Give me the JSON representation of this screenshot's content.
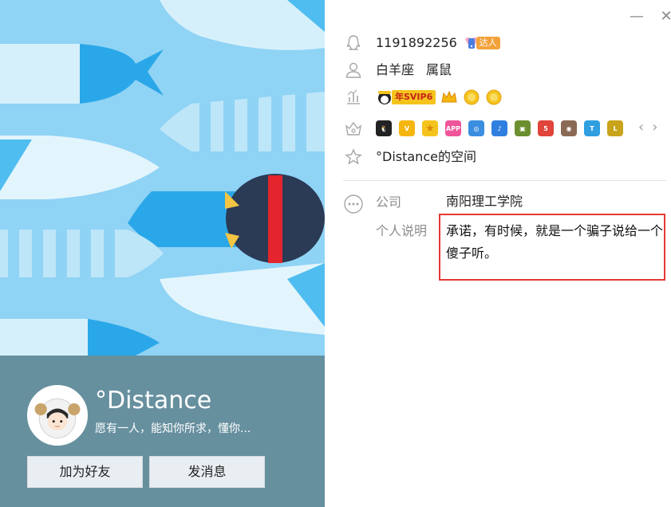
{
  "window": {
    "minimize_glyph": "—",
    "close_glyph": "✕"
  },
  "profile": {
    "nickname": "°Distance",
    "signature": "愿有一人，能知你所求，懂你...",
    "add_friend_label": "加为好友",
    "send_message_label": "发消息"
  },
  "info": {
    "qq_number": "1191892256",
    "talent_badge": "达人",
    "zodiac": "白羊座",
    "chinese_zodiac": "属鼠",
    "vip_badge": "年SVIP6",
    "qzone": "°Distance的空间"
  },
  "details": {
    "company_label": "公司",
    "company_value": "南阳理工学院",
    "description_label": "个人说明",
    "description_value": "承诺，有时候，就是一个骗子说给一个傻子听。"
  },
  "icons": {
    "qq": "qq-penguin-icon",
    "person": "person-icon",
    "level": "level-chart-icon",
    "apps": "crown-apps-icon",
    "star": "star-icon",
    "more": "more-dots-icon"
  },
  "app_badges": [
    "qq-penguin",
    "vip-ticket",
    "star-badge",
    "app-tag",
    "camera",
    "music",
    "gift-box",
    "game-5",
    "cow",
    "shield-t",
    "l-badge"
  ],
  "colors": {
    "profile_bar": "#67909f",
    "accent_red": "#e53935",
    "sky": "#8fd3f5"
  }
}
